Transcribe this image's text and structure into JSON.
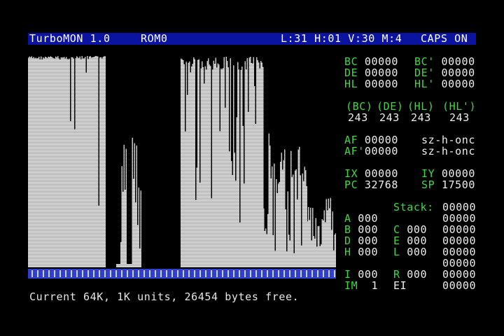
{
  "title_bar": {
    "app_name": "TurboMON 1.0",
    "rom": "ROM0",
    "cursor_info": "L:31 H:01 V:30 M:4",
    "caps": "CAPS ON"
  },
  "status_line": "Current 64K, 1K units, 26454 bytes free.",
  "colors": {
    "title_bar_bg": "#0a14a0",
    "register_label": "#3ddc3d",
    "register_value": "#eeeeee",
    "memory_bar": "#3040c8"
  },
  "registers": {
    "pairs": [
      {
        "label": "BC",
        "value": "00000",
        "alt_label": "BC'",
        "alt_value": "00000"
      },
      {
        "label": "DE",
        "value": "00000",
        "alt_label": "DE'",
        "alt_value": "00000"
      },
      {
        "label": "HL",
        "value": "00000",
        "alt_label": "HL'",
        "alt_value": "00000"
      }
    ],
    "indirect": {
      "labels": [
        "(BC)",
        "(DE)",
        "(HL)",
        "(HL')"
      ],
      "values": [
        "243",
        "243",
        "243",
        "243"
      ]
    },
    "af": {
      "label": "AF",
      "value": "00000",
      "flags": "sz-h-onc"
    },
    "af_alt": {
      "label": "AF'",
      "value": "00000",
      "flags": "sz-h-onc"
    },
    "ix": {
      "label": "IX",
      "value": "00000"
    },
    "iy": {
      "label": "IY",
      "value": "00000"
    },
    "pc": {
      "label": "PC",
      "value": "32768"
    },
    "sp": {
      "label": "SP",
      "value": "17500"
    },
    "singles_left": [
      {
        "label": "A",
        "value": "000"
      },
      {
        "label": "B",
        "value": "000"
      },
      {
        "label": "D",
        "value": "000"
      },
      {
        "label": "H",
        "value": "000"
      }
    ],
    "singles_right": [
      {
        "label": "C",
        "value": "000"
      },
      {
        "label": "E",
        "value": "000"
      },
      {
        "label": "L",
        "value": "000"
      }
    ],
    "i": {
      "label": "I",
      "value": "000"
    },
    "r": {
      "label": "R",
      "value": "000"
    },
    "im": {
      "label": "IM",
      "value": "1"
    },
    "ei": "EI"
  },
  "stack": {
    "label": "Stack:",
    "values": [
      "00000",
      "00000",
      "00000",
      "00000",
      "00000",
      "00000",
      "00000",
      "00000"
    ]
  }
}
